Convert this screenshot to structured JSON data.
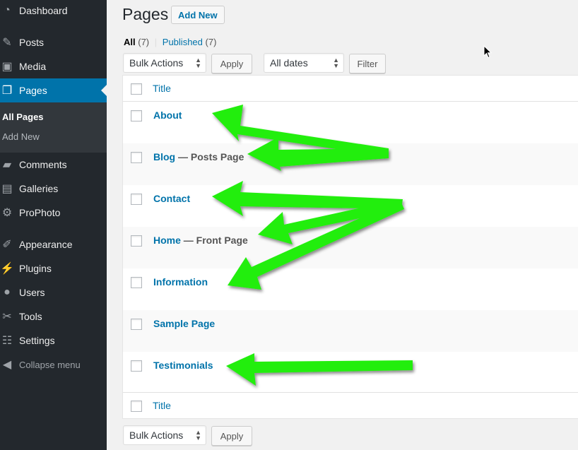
{
  "sidebar": {
    "items": [
      {
        "label": "Dashboard",
        "icon": "dashboard-icon"
      },
      {
        "label": "Posts",
        "icon": "pin-icon"
      },
      {
        "label": "Media",
        "icon": "media-icon"
      },
      {
        "label": "Pages",
        "icon": "pages-icon",
        "current": true
      },
      {
        "label": "Comments",
        "icon": "comment-icon"
      },
      {
        "label": "Galleries",
        "icon": "gallery-icon"
      },
      {
        "label": "ProPhoto",
        "icon": "gear-icon"
      },
      {
        "label": "Appearance",
        "icon": "brush-icon"
      },
      {
        "label": "Plugins",
        "icon": "plug-icon"
      },
      {
        "label": "Users",
        "icon": "user-icon"
      },
      {
        "label": "Tools",
        "icon": "wrench-icon"
      },
      {
        "label": "Settings",
        "icon": "settings-sliders-icon"
      }
    ],
    "submenu": {
      "all_pages": "All Pages",
      "add_new": "Add New"
    },
    "collapse": "Collapse menu"
  },
  "header": {
    "title": "Pages",
    "add_new": "Add New"
  },
  "views": {
    "all_label": "All",
    "all_count": "(7)",
    "separator": "|",
    "published_label": "Published",
    "published_count": "(7)"
  },
  "filters": {
    "bulk_actions": "Bulk Actions",
    "apply": "Apply",
    "dates": "All dates",
    "filter": "Filter"
  },
  "table": {
    "column_title": "Title",
    "rows": [
      {
        "title": "About",
        "state": ""
      },
      {
        "title": "Blog",
        "state": " — Posts Page"
      },
      {
        "title": "Contact",
        "state": ""
      },
      {
        "title": "Home",
        "state": " — Front Page"
      },
      {
        "title": "Information",
        "state": ""
      },
      {
        "title": "Sample Page",
        "state": ""
      },
      {
        "title": "Testimonials",
        "state": ""
      }
    ]
  },
  "colors": {
    "sidebar_bg": "#23282d",
    "accent": "#0073aa",
    "annotation_arrow": "#00ff00"
  }
}
